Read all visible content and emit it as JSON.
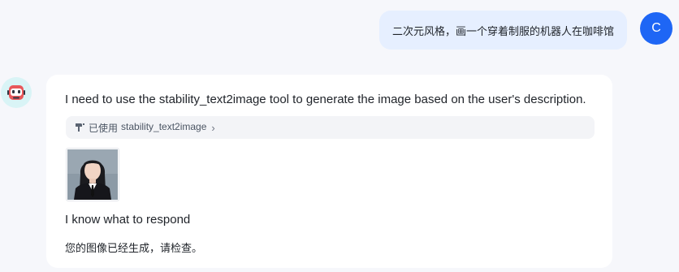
{
  "user": {
    "avatar_letter": "C",
    "message": "二次元风格，画一个穿着制服的机器人在咖啡馆"
  },
  "assistant": {
    "avatar_icon": "robot-icon",
    "intro": "I need to use the stability_text2image tool to generate the image based on the user's description.",
    "tool_call": {
      "prefix": "已使用",
      "tool_name": "stability_text2image",
      "icon": "tool-icon"
    },
    "image_alt": "generated portrait image",
    "know_text": "I know what to respond",
    "final_text": "您的图像已经生成，请检查。"
  },
  "colors": {
    "page_bg": "#f6f7fb",
    "user_bubble_bg": "#e6efff",
    "user_avatar_bg": "#1e66f5",
    "bot_avatar_bg": "#d9f4f6",
    "card_bg": "#ffffff",
    "tool_chip_bg": "#f3f4f7"
  }
}
